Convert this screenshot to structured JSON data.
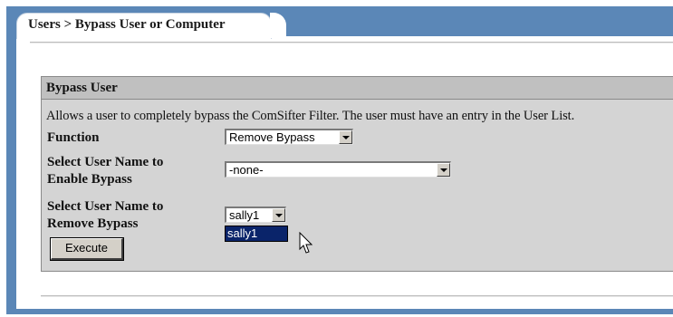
{
  "breadcrumb": "Users > Bypass User or Computer",
  "section": {
    "title": "Bypass User",
    "description": "Allows a user to completely bypass the ComSifter Filter. The user must have an entry in the User List."
  },
  "form": {
    "function_label": "Function",
    "function_value": "Remove Bypass",
    "enable_label_line1": "Select User Name to",
    "enable_label_line2": "Enable Bypass",
    "enable_value": "-none-",
    "remove_label_line1": "Select User Name to",
    "remove_label_line2": "Remove Bypass",
    "remove_value": "sally1",
    "remove_dropdown_option": "sally1",
    "execute_label": "Execute"
  },
  "icons": {
    "cursor": "mouse-pointer-icon",
    "dropdown_arrow": "chevron-down-icon"
  },
  "colors": {
    "frame": "#5b87b7",
    "box": "#d4d4d4",
    "box_header": "#c0c0c0",
    "highlight": "#0a246a"
  }
}
